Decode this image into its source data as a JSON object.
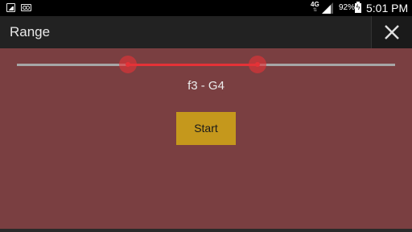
{
  "status_bar": {
    "network": "4G",
    "battery": "92%",
    "time": "5:01 PM",
    "icons": [
      "image-notification-icon",
      "voicemail-icon",
      "signal-icon",
      "battery-charging-icon"
    ]
  },
  "action_bar": {
    "title": "Range",
    "close_icon": "close-icon"
  },
  "range_slider": {
    "low_fraction": 0.295,
    "high_fraction": 0.637,
    "value_text": "f3 - G4"
  },
  "start_button": {
    "label": "Start"
  },
  "colors": {
    "background": "#7a3f41",
    "action_bar": "#222222",
    "accent": "#e53237",
    "button": "#c5981c"
  }
}
